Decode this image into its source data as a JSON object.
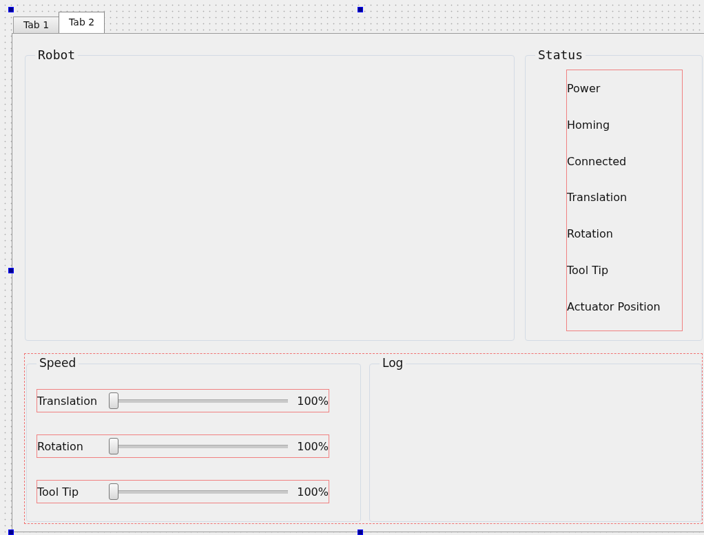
{
  "tabs": [
    {
      "label": "Tab 1",
      "selected": false
    },
    {
      "label": "Tab 2",
      "selected": true
    }
  ],
  "robot": {
    "title": "Robot"
  },
  "status": {
    "title": "Status",
    "items": [
      "Power",
      "Homing",
      "Connected",
      "Translation",
      "Rotation",
      "Tool Tip",
      "Actuator Position"
    ]
  },
  "speed": {
    "title": "Speed",
    "sliders": [
      {
        "label": "Translation",
        "level": 0,
        "reading": "100%"
      },
      {
        "label": "Rotation",
        "level": 0,
        "reading": "100%"
      },
      {
        "label": "Tool Tip",
        "level": 0,
        "reading": "100%"
      }
    ]
  },
  "log": {
    "title": "Log"
  }
}
